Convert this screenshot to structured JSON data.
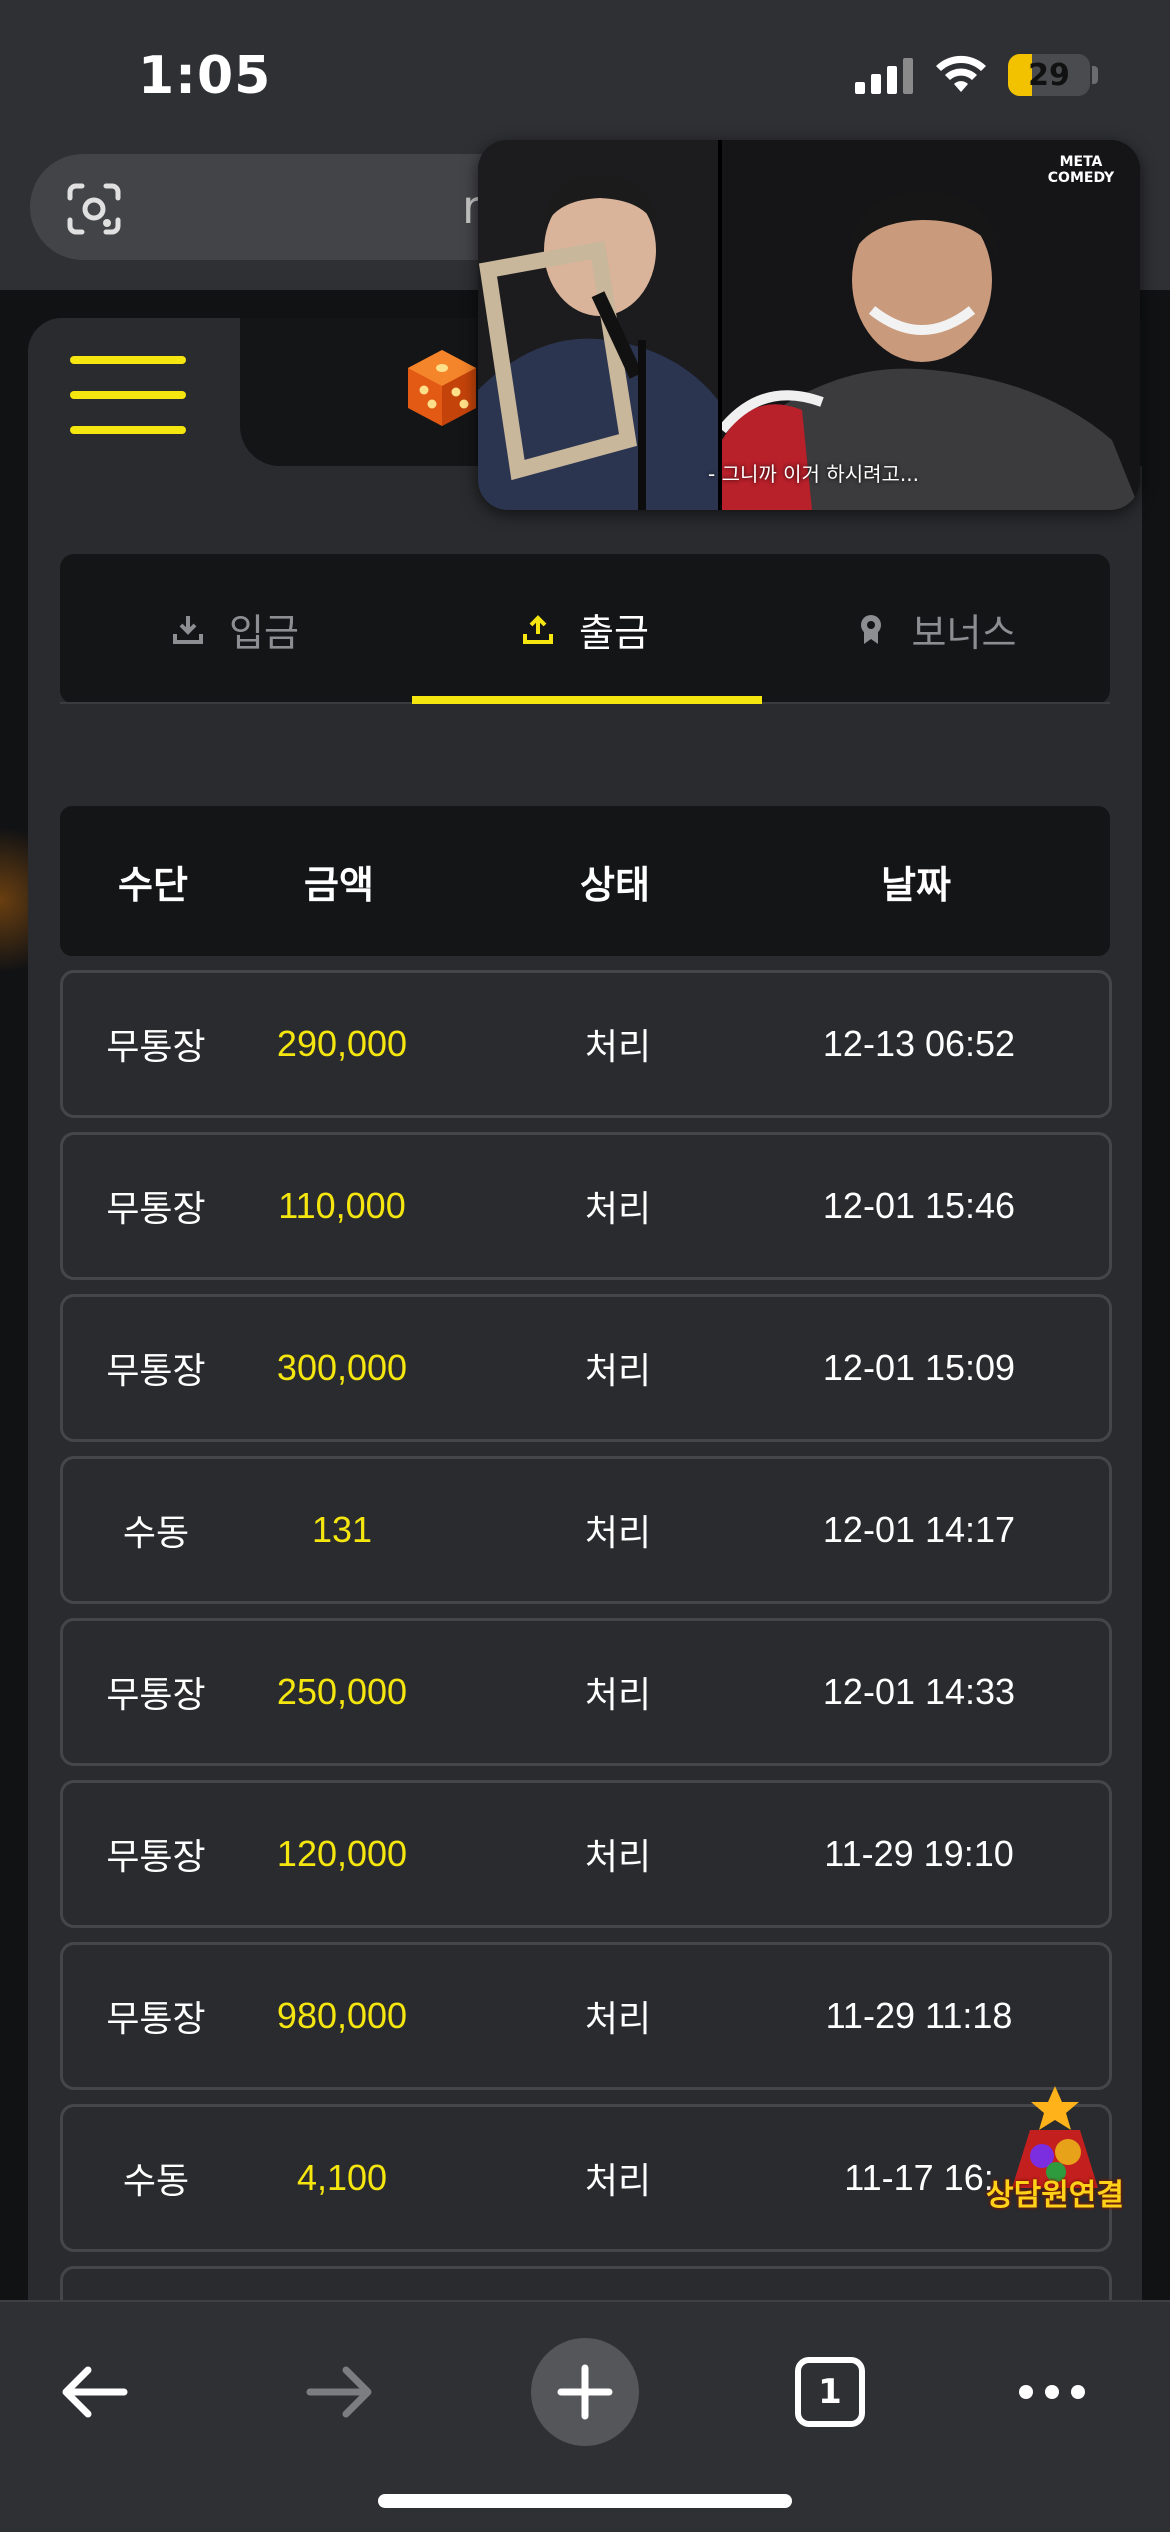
{
  "status_bar": {
    "time": "1:05",
    "battery": "29",
    "battery_level": 0.29
  },
  "browser": {
    "url_fragment": "r"
  },
  "tabs": [
    {
      "label": "입금",
      "icon": "download-icon"
    },
    {
      "label": "출금",
      "icon": "upload-icon",
      "active": true
    },
    {
      "label": "보너스",
      "icon": "badge-icon"
    }
  ],
  "table": {
    "headers": {
      "method": "수단",
      "amount": "금액",
      "status": "상태",
      "date": "날짜"
    },
    "rows": [
      {
        "method": "무통장",
        "amount": "290,000",
        "status": "처리",
        "date": "12-13 06:52"
      },
      {
        "method": "무통장",
        "amount": "110,000",
        "status": "처리",
        "date": "12-01 15:46"
      },
      {
        "method": "무통장",
        "amount": "300,000",
        "status": "처리",
        "date": "12-01 15:09"
      },
      {
        "method": "수동",
        "amount": "131",
        "status": "처리",
        "date": "12-01 14:17"
      },
      {
        "method": "무통장",
        "amount": "250,000",
        "status": "처리",
        "date": "12-01 14:33"
      },
      {
        "method": "무통장",
        "amount": "120,000",
        "status": "처리",
        "date": "11-29 19:10"
      },
      {
        "method": "무통장",
        "amount": "980,000",
        "status": "처리",
        "date": "11-29 11:18"
      },
      {
        "method": "수동",
        "amount": "4,100",
        "status": "처리",
        "date": "11-17 16:"
      }
    ]
  },
  "pip": {
    "caption": "- 그니까 이거 하시려고...",
    "logo": "META COMEDY"
  },
  "support": {
    "label": "상담원연결"
  },
  "toolbar": {
    "tab_count": "1"
  },
  "colors": {
    "accent": "#f5e60f",
    "panel": "#2a2b2e",
    "dark": "#141517"
  }
}
